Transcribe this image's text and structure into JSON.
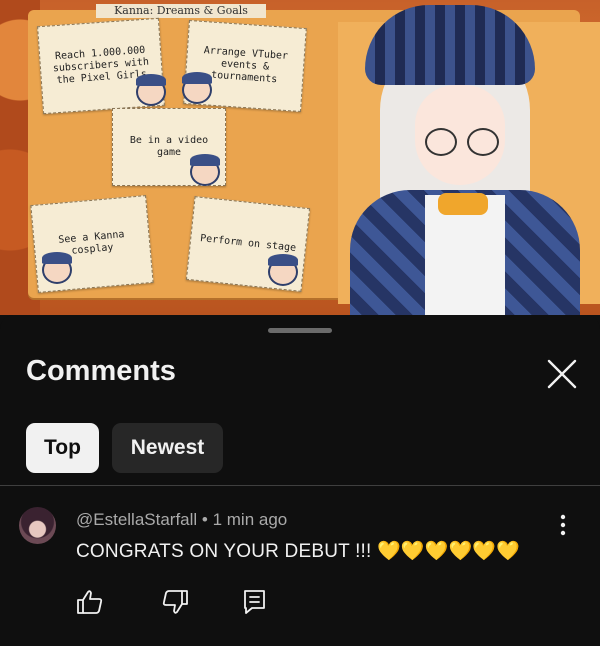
{
  "video": {
    "board_title": "Kanna: Dreams & Goals",
    "notes": [
      "Reach 1.000.000 subscribers with the Pixel Girls",
      "Arrange VTuber events & tournaments",
      "Be in a video game",
      "See a Kanna cosplay",
      "Perform on stage"
    ]
  },
  "comments_panel": {
    "title": "Comments",
    "close_icon": "close-icon",
    "sort_tabs": [
      {
        "label": "Top",
        "selected": true
      },
      {
        "label": "Newest",
        "selected": false
      }
    ],
    "comments": [
      {
        "author": "@EstellaStarfall",
        "time": "1 min ago",
        "author_line": "@EstellaStarfall • 1 min ago",
        "text": "CONGRATS ON YOUR DEBUT !!! 💛💛💛💛💛💛",
        "actions": [
          "like-icon",
          "dislike-icon",
          "reply-icon"
        ]
      }
    ]
  },
  "colors": {
    "background": "#0f0f0f",
    "chip_selected": "#f1f1f1",
    "chip_unselected": "#272727",
    "secondary_text": "#aaaaaa"
  }
}
